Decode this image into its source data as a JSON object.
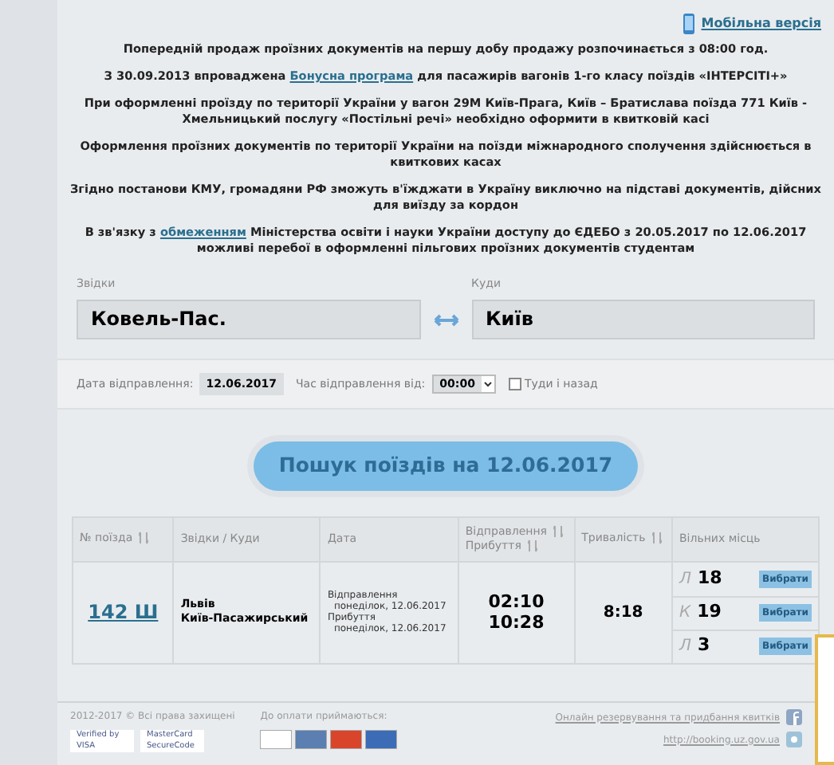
{
  "mobile_link": "Мобільна версія",
  "notices": [
    "Попередній продаж проїзних документів на першу добу продажу розпочинається з 08:00 год.",
    {
      "before": "З 30.09.2013 впроваджена ",
      "link": "Бонусна програма",
      "after": " для пасажирів вагонів 1-го класу поїздів «ІНТЕРСІТІ+»"
    },
    "При оформленні проїзду по території України у вагон 29М Київ-Прага, Київ – Братислава поїзда 771 Київ - Хмельницький послугу «Постільні речі» необхідно оформити в квитковій касі",
    "Оформлення проїзних документів по території України на поїзди міжнародного сполучення здійснюється в квиткових касах",
    "Згідно постанови КМУ, громадяни РФ зможуть в'їжджати в Україну виключно на підставі документів, дійсних для виїзду за кордон",
    {
      "before": "В зв'язку з ",
      "link": "обмеженням",
      "after": " Міністерства освіти і науки України доступу до ЄДЕБО з 20.05.2017 по 12.06.2017 можливі перебої в оформленні пільгових проїзних документів студентам"
    }
  ],
  "from": {
    "label": "Звідки",
    "value": "Ковель-Пас."
  },
  "to": {
    "label": "Куди",
    "value": "Київ"
  },
  "date": {
    "label": "Дата відправлення:",
    "value": "12.06.2017"
  },
  "time": {
    "label": "Час відправлення від:",
    "value": "00:00"
  },
  "round_trip": {
    "label": "Туди і назад",
    "checked": false
  },
  "search_button": "Пошук поїздів на 12.06.2017",
  "table": {
    "columns": [
      [
        "№ поїзда"
      ],
      [
        "Звідки / Куди"
      ],
      [
        "Дата"
      ],
      [
        "Відправлення",
        "Прибуття"
      ],
      [
        "Тривалість"
      ],
      [
        "Вільних місць"
      ]
    ],
    "rows": [
      {
        "train": "142 Ш",
        "from": "Львів",
        "to": "Київ-Пасажирський",
        "dep_label": "Відправлення",
        "dep_date": "понеділок, 12.06.2017",
        "arr_label": "Прибуття",
        "arr_date": "понеділок, 12.06.2017",
        "dep_time": "02:10",
        "arr_time": "10:28",
        "duration": "8:18",
        "seats": [
          {
            "class": "Л",
            "count": "18",
            "button": "Вибрати"
          },
          {
            "class": "К",
            "count": "19",
            "button": "Вибрати"
          },
          {
            "class": "Л",
            "count": "3",
            "button": "Вибрати"
          }
        ]
      }
    ]
  },
  "footer": {
    "copyright": "2012-2017 © Всі права захищені",
    "payment_label": "До оплати приймаються:",
    "badges": [
      "Verified by VISA",
      "MasterCard SecureCode"
    ],
    "cards": [
      {
        "color": "#ffffff"
      },
      {
        "color": "#5a7fb0"
      },
      {
        "color": "#d9452b"
      },
      {
        "color": "#3b6cb5"
      }
    ],
    "booking_link": "Онлайн резервування та придбання квитків",
    "url": "http://booking.uz.gov.ua"
  }
}
